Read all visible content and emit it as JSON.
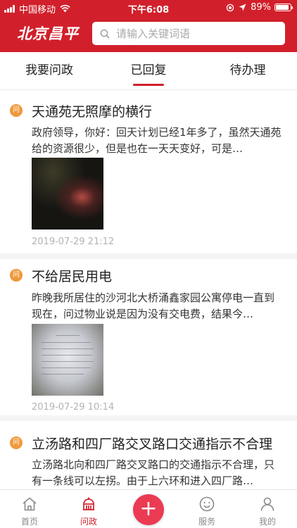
{
  "status_bar": {
    "carrier": "中国移动",
    "time": "下午6:08",
    "battery": "89%",
    "battery_level": 0.89
  },
  "header": {
    "logo": "北京昌平",
    "search_placeholder": "请输入关键词语",
    "brand_color": "#d1202b"
  },
  "tabs": [
    {
      "label": "我要问政",
      "active": false
    },
    {
      "label": "已回复",
      "active": true
    },
    {
      "label": "待办理",
      "active": false
    }
  ],
  "posts": [
    {
      "badge": "问",
      "title": "天通苑无照摩的横行",
      "body": "政府领导，你好：回天计划已经1年多了，虽然天通苑给的资源很少，但是也在一天天变好，可是…",
      "time": "2019-07-29 21:12",
      "photo": "dark-street-photo"
    },
    {
      "badge": "问",
      "title": "不给居民用电",
      "body": "昨晚我所居住的沙河北大桥涌鑫家园公寓停电一直到现在，问过物业说是因为没有交电费，结果今…",
      "time": "2019-07-29 10:14",
      "photo": "notice-paper-photo"
    },
    {
      "badge": "问",
      "title": "立汤路和四厂路交叉路口交通指示不合理",
      "body": "立汤路北向和四厂路交叉路口的交通指示不合理，只有一条线可以左拐。由于上六环和进入四厂路…"
    }
  ],
  "tabbar": {
    "items": [
      {
        "label": "首页",
        "icon": "home-icon",
        "active": false
      },
      {
        "label": "问政",
        "icon": "building-icon",
        "active": true
      },
      {
        "label": "服务",
        "icon": "smile-icon",
        "active": false
      },
      {
        "label": "我的",
        "icon": "user-icon",
        "active": false
      }
    ],
    "plus": "+"
  }
}
